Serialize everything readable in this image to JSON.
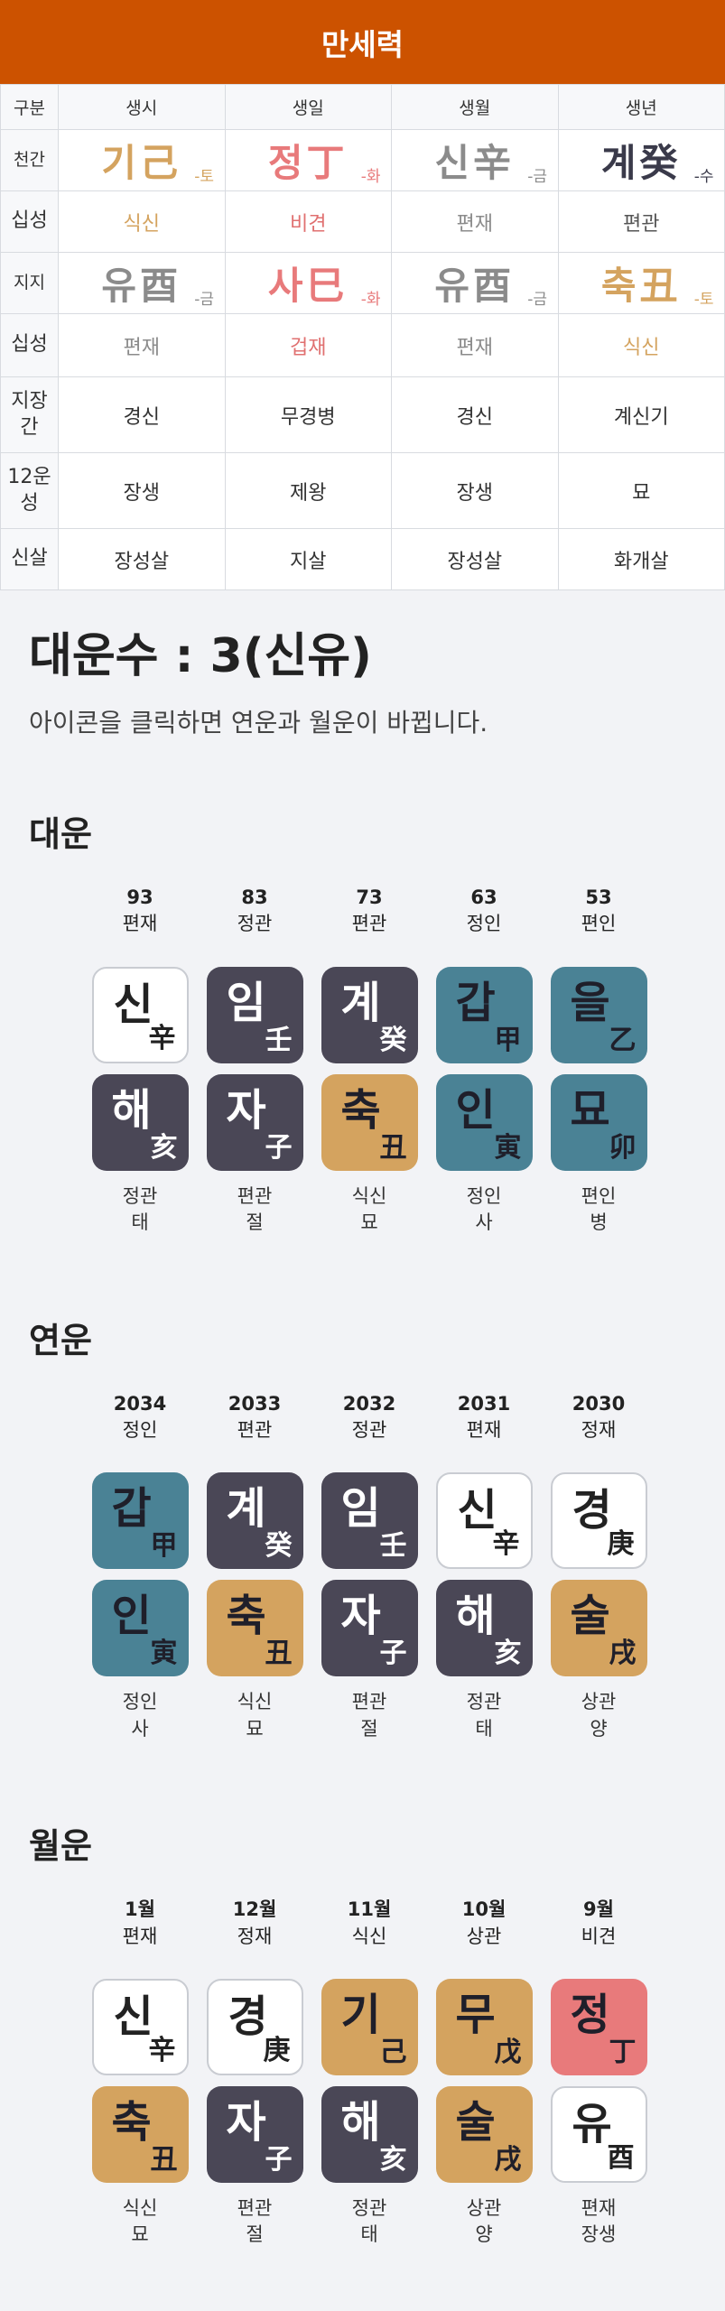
{
  "header": {
    "title": "만세력"
  },
  "table": {
    "headers": [
      "구분",
      "생시",
      "생일",
      "생월",
      "생년"
    ],
    "cheongan": {
      "label": "천간",
      "cells": [
        {
          "text": "기己",
          "element": "-토",
          "color": "#d4a35f"
        },
        {
          "text": "정丁",
          "element": "-화",
          "color": "#e87a7b"
        },
        {
          "text": "신辛",
          "element": "-금",
          "color": "#8b8b8b"
        },
        {
          "text": "계癸",
          "element": "-수",
          "color": "#3a3a4a"
        }
      ]
    },
    "sipseong1": {
      "label": "십성",
      "cells": [
        {
          "text": "식신",
          "color": "#d4a35f"
        },
        {
          "text": "비견",
          "color": "#e07070"
        },
        {
          "text": "편재",
          "color": "#8b8b8b"
        },
        {
          "text": "편관",
          "color": "#555555"
        }
      ]
    },
    "jiji": {
      "label": "지지",
      "cells": [
        {
          "text": "유酉",
          "element": "-금",
          "color": "#8b8b8b"
        },
        {
          "text": "사巳",
          "element": "-화",
          "color": "#e87a7b"
        },
        {
          "text": "유酉",
          "element": "-금",
          "color": "#8b8b8b"
        },
        {
          "text": "축丑",
          "element": "-토",
          "color": "#d4a35f"
        }
      ]
    },
    "sipseong2": {
      "label": "십성",
      "cells": [
        {
          "text": "편재",
          "color": "#8b8b8b"
        },
        {
          "text": "겁재",
          "color": "#e07070"
        },
        {
          "text": "편재",
          "color": "#8b8b8b"
        },
        {
          "text": "식신",
          "color": "#d4a35f"
        }
      ]
    },
    "jijanggan": {
      "label": "지장간",
      "cells": [
        "경신",
        "무경병",
        "경신",
        "계신기"
      ]
    },
    "unseong": {
      "label": "12운성",
      "cells": [
        "장생",
        "제왕",
        "장생",
        "묘"
      ]
    },
    "sinsal": {
      "label": "신살",
      "cells": [
        "장성살",
        "지살",
        "장성살",
        "화개살"
      ]
    }
  },
  "daeunsu": {
    "title": "대운수 : 3(신유)",
    "subtitle": "아이콘을 클릭하면 연운과 월운이 바뀝니다."
  },
  "daeun": {
    "title": "대운",
    "items": [
      {
        "top1": "93",
        "top2": "편재",
        "stem": {
          "k": "신",
          "h": "辛",
          "style": "t-white"
        },
        "branch": {
          "k": "해",
          "h": "亥",
          "style": "t-dark"
        },
        "bot1": "정관",
        "bot2": "태"
      },
      {
        "top1": "83",
        "top2": "정관",
        "stem": {
          "k": "임",
          "h": "壬",
          "style": "t-dark"
        },
        "branch": {
          "k": "자",
          "h": "子",
          "style": "t-dark"
        },
        "bot1": "편관",
        "bot2": "절"
      },
      {
        "top1": "73",
        "top2": "편관",
        "stem": {
          "k": "계",
          "h": "癸",
          "style": "t-dark"
        },
        "branch": {
          "k": "축",
          "h": "丑",
          "style": "t-gold"
        },
        "bot1": "식신",
        "bot2": "묘"
      },
      {
        "top1": "63",
        "top2": "정인",
        "stem": {
          "k": "갑",
          "h": "甲",
          "style": "t-teal"
        },
        "branch": {
          "k": "인",
          "h": "寅",
          "style": "t-teal"
        },
        "bot1": "정인",
        "bot2": "사"
      },
      {
        "top1": "53",
        "top2": "편인",
        "stem": {
          "k": "을",
          "h": "乙",
          "style": "t-teal"
        },
        "branch": {
          "k": "묘",
          "h": "卯",
          "style": "t-teal"
        },
        "bot1": "편인",
        "bot2": "병"
      }
    ]
  },
  "yeonun": {
    "title": "연운",
    "items": [
      {
        "top1": "2034",
        "top2": "정인",
        "stem": {
          "k": "갑",
          "h": "甲",
          "style": "t-teal"
        },
        "branch": {
          "k": "인",
          "h": "寅",
          "style": "t-teal"
        },
        "bot1": "정인",
        "bot2": "사"
      },
      {
        "top1": "2033",
        "top2": "편관",
        "stem": {
          "k": "계",
          "h": "癸",
          "style": "t-dark"
        },
        "branch": {
          "k": "축",
          "h": "丑",
          "style": "t-gold"
        },
        "bot1": "식신",
        "bot2": "묘"
      },
      {
        "top1": "2032",
        "top2": "정관",
        "stem": {
          "k": "임",
          "h": "壬",
          "style": "t-dark"
        },
        "branch": {
          "k": "자",
          "h": "子",
          "style": "t-dark"
        },
        "bot1": "편관",
        "bot2": "절"
      },
      {
        "top1": "2031",
        "top2": "편재",
        "stem": {
          "k": "신",
          "h": "辛",
          "style": "t-white"
        },
        "branch": {
          "k": "해",
          "h": "亥",
          "style": "t-dark"
        },
        "bot1": "정관",
        "bot2": "태"
      },
      {
        "top1": "2030",
        "top2": "정재",
        "stem": {
          "k": "경",
          "h": "庚",
          "style": "t-white"
        },
        "branch": {
          "k": "술",
          "h": "戌",
          "style": "t-gold"
        },
        "bot1": "상관",
        "bot2": "양"
      }
    ]
  },
  "wolun": {
    "title": "월운",
    "items": [
      {
        "top1": "1월",
        "top2": "편재",
        "stem": {
          "k": "신",
          "h": "辛",
          "style": "t-white"
        },
        "branch": {
          "k": "축",
          "h": "丑",
          "style": "t-gold"
        },
        "bot1": "식신",
        "bot2": "묘"
      },
      {
        "top1": "12월",
        "top2": "정재",
        "stem": {
          "k": "경",
          "h": "庚",
          "style": "t-white"
        },
        "branch": {
          "k": "자",
          "h": "子",
          "style": "t-dark"
        },
        "bot1": "편관",
        "bot2": "절"
      },
      {
        "top1": "11월",
        "top2": "식신",
        "stem": {
          "k": "기",
          "h": "己",
          "style": "t-gold"
        },
        "branch": {
          "k": "해",
          "h": "亥",
          "style": "t-dark"
        },
        "bot1": "정관",
        "bot2": "태"
      },
      {
        "top1": "10월",
        "top2": "상관",
        "stem": {
          "k": "무",
          "h": "戊",
          "style": "t-gold"
        },
        "branch": {
          "k": "술",
          "h": "戌",
          "style": "t-gold"
        },
        "bot1": "상관",
        "bot2": "양"
      },
      {
        "top1": "9월",
        "top2": "비견",
        "stem": {
          "k": "정",
          "h": "丁",
          "style": "t-red"
        },
        "branch": {
          "k": "유",
          "h": "酉",
          "style": "t-white"
        },
        "bot1": "편재",
        "bot2": "장생"
      }
    ]
  }
}
